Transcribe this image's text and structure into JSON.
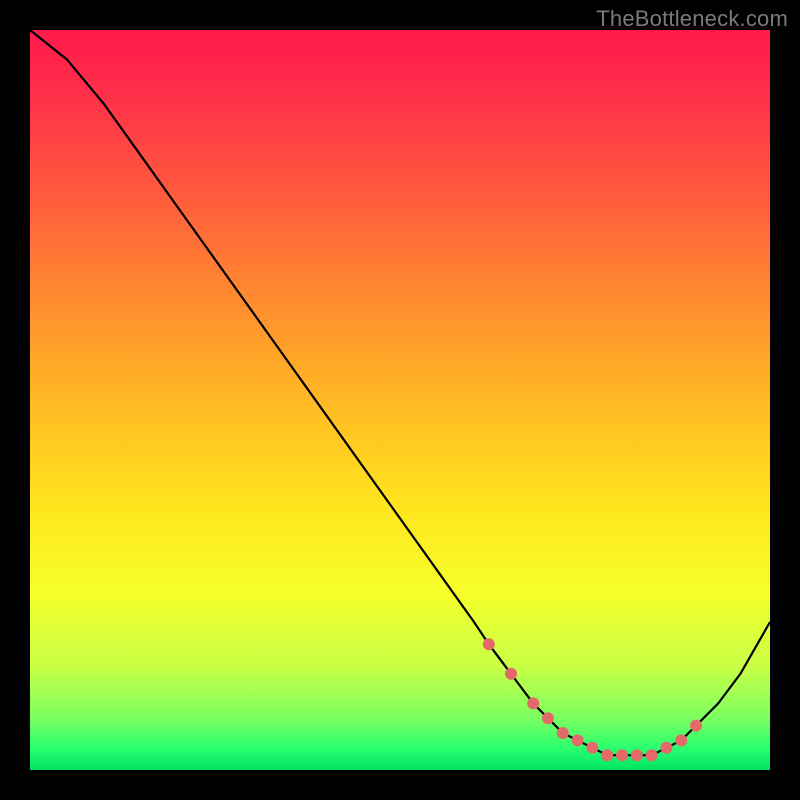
{
  "watermark": "TheBottleneck.com",
  "colors": {
    "line": "#000000",
    "marker": "#e46a6a",
    "frame_bg": "#000000"
  },
  "chart_data": {
    "type": "line",
    "title": "",
    "xlabel": "",
    "ylabel": "",
    "xlim": [
      0,
      100
    ],
    "ylim": [
      0,
      100
    ],
    "x": [
      0,
      5,
      10,
      15,
      20,
      25,
      30,
      35,
      40,
      45,
      50,
      55,
      60,
      62,
      65,
      68,
      70,
      72,
      74,
      76,
      78,
      80,
      82,
      84,
      86,
      88,
      90,
      93,
      96,
      100
    ],
    "y": [
      100,
      96,
      90,
      83,
      76,
      69,
      62,
      55,
      48,
      41,
      34,
      27,
      20,
      17,
      13,
      9,
      7,
      5,
      4,
      3,
      2,
      2,
      2,
      2,
      3,
      4,
      6,
      9,
      13,
      20
    ],
    "markers_x": [
      62,
      65,
      68,
      70,
      72,
      74,
      76,
      78,
      80,
      82,
      84,
      86,
      88,
      90
    ],
    "markers_y": [
      17,
      13,
      9,
      7,
      5,
      4,
      3,
      2,
      2,
      2,
      2,
      3,
      4,
      6
    ]
  }
}
